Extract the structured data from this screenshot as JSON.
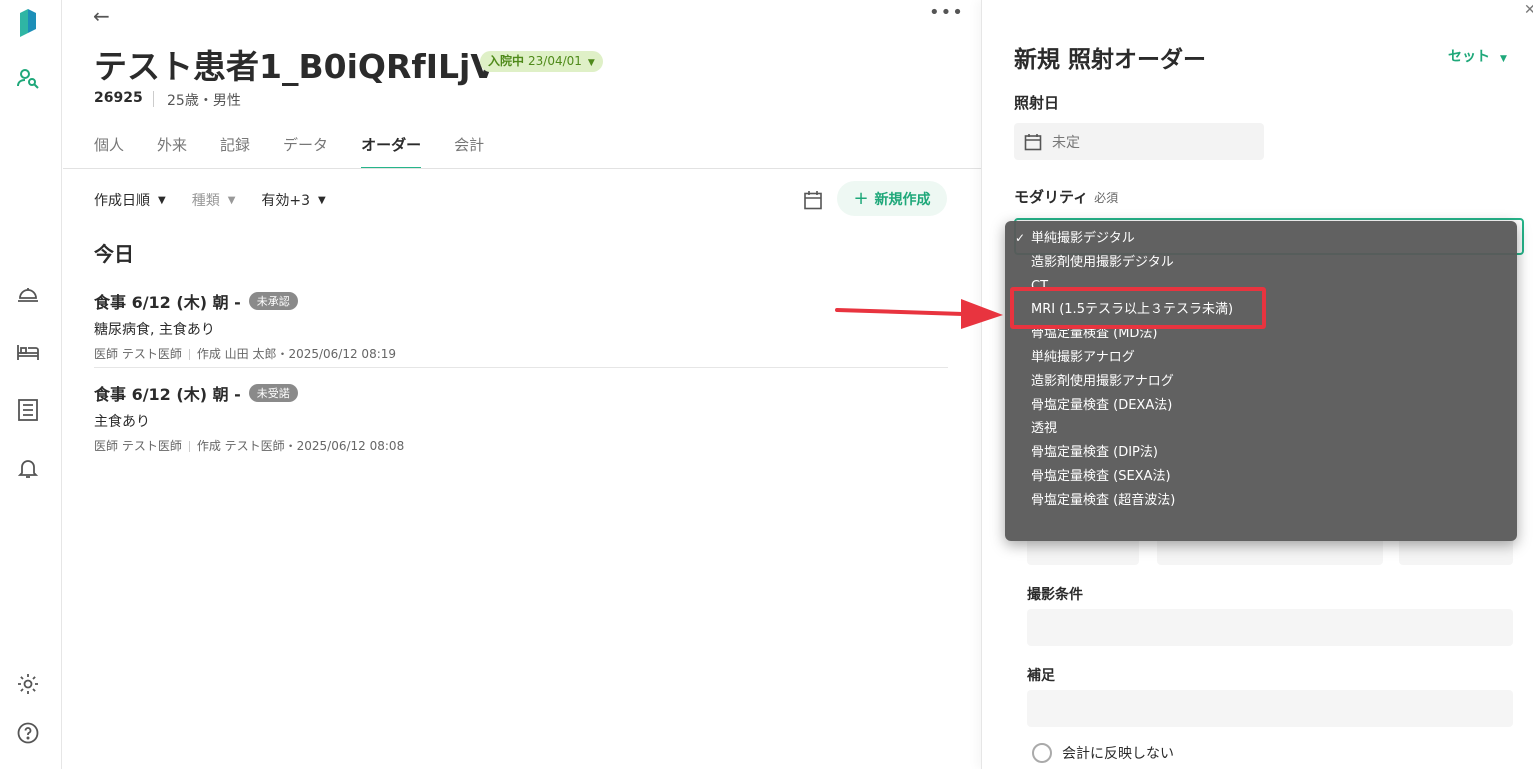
{
  "rail": {
    "logo": "app-logo",
    "icons": [
      "patient-search-icon",
      "food-tray-icon",
      "bed-icon",
      "list-icon",
      "bell-icon",
      "gear-icon",
      "help-icon"
    ]
  },
  "patient": {
    "name": "テスト患者1_B0iQRfILjV",
    "admission_status": "入院中",
    "admission_date": "23/04/01",
    "id": "26925",
    "info": "25歳・男性"
  },
  "tabs": [
    "個人",
    "外来",
    "記録",
    "データ",
    "オーダー",
    "会計"
  ],
  "active_tab": "オーダー",
  "filters": {
    "sort": "作成日順",
    "type": "種類",
    "status": "有効+3"
  },
  "new_button": "新規作成",
  "section_title": "今日",
  "orders": [
    {
      "title": "食事 6/12 (木) 朝 -",
      "badge": "未承認",
      "detail": "糖尿病食, 主食あり",
      "doctor": "医師 テスト医師",
      "meta": "作成 山田 太郎・2025/06/12 08:19"
    },
    {
      "title": "食事 6/12 (木) 朝 -",
      "badge": "未受諾",
      "detail": "主食あり",
      "doctor": "医師 テスト医師",
      "meta": "作成 テスト医師・2025/06/12 08:08"
    }
  ],
  "panel": {
    "title": "新規 照射オーダー",
    "set_label": "セット",
    "date_label": "照射日",
    "date_value": "未定",
    "modality_label": "モダリティ",
    "required_label": "必須",
    "conditions_label": "撮影条件",
    "notes_label": "補足",
    "no_billing_label": "会計に反映しない"
  },
  "dropdown": {
    "options": [
      "単純撮影デジタル",
      "造影剤使用撮影デジタル",
      "CT",
      "MRI (1.5テスラ以上３テスラ未満)",
      "骨塩定量検査 (MD法)",
      "単純撮影アナログ",
      "造影剤使用撮影アナログ",
      "骨塩定量検査 (DEXA法)",
      "透視",
      "骨塩定量検査 (DIP法)",
      "骨塩定量検査 (SEXA法)",
      "骨塩定量検査 (超音波法)"
    ],
    "selected": "単純撮影デジタル",
    "highlighted": "MRI (1.5テスラ以上３テスラ未満)"
  },
  "colors": {
    "accent": "#26b58a",
    "annotation": "#e8343f",
    "badge": "#8a8a8a",
    "admission_bg": "#dff0c7"
  }
}
